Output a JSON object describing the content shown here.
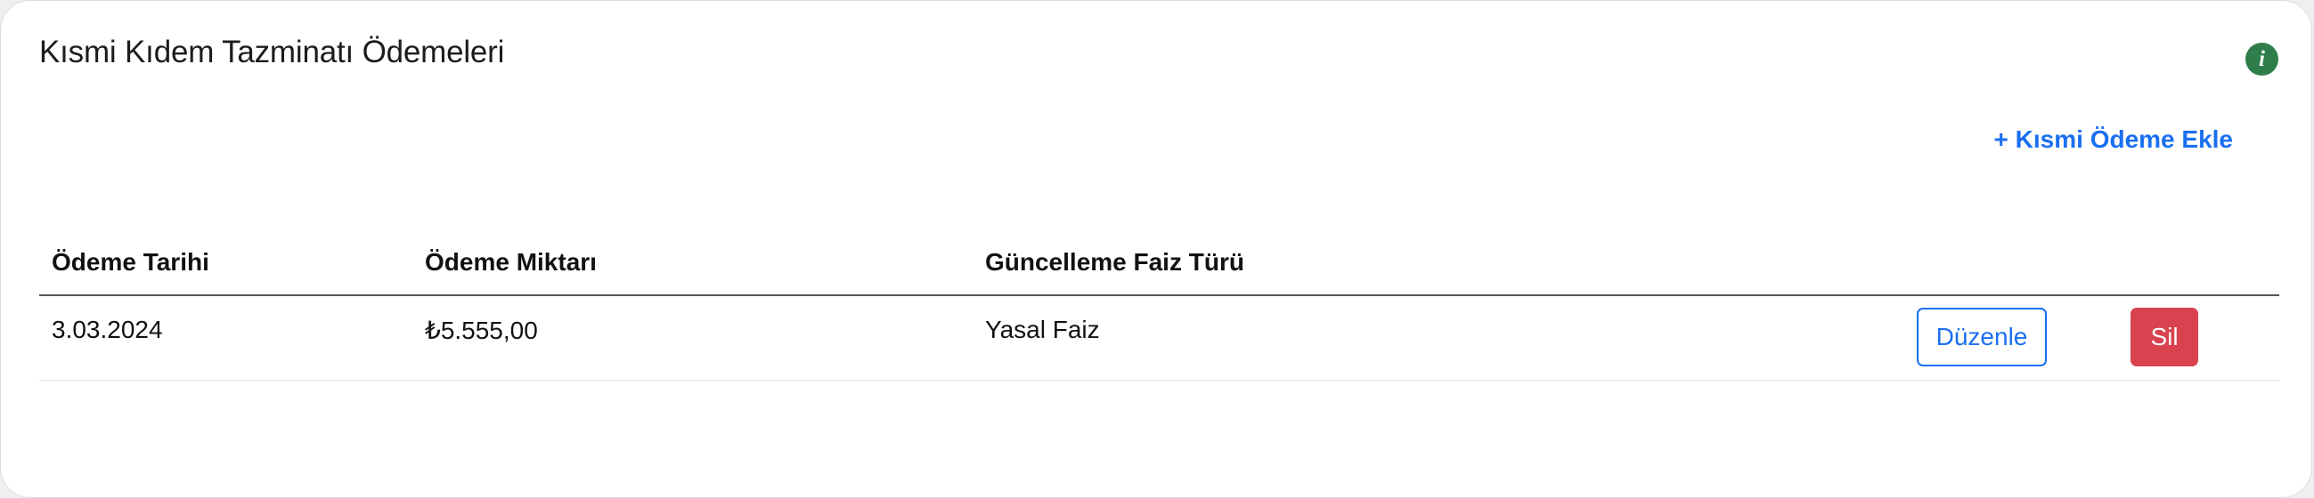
{
  "card": {
    "title": "Kısmi Kıdem Tazminatı Ödemeleri",
    "info_icon": "info-icon",
    "add_link_label": "+ Kısmi Ödeme Ekle"
  },
  "table": {
    "headers": [
      "Ödeme Tarihi",
      "Ödeme Miktarı",
      "Güncelleme Faiz Türü"
    ],
    "rows": [
      {
        "date": "3.03.2024",
        "amount": "₺5.555,00",
        "interest_type": "Yasal Faiz",
        "edit_label": "Düzenle",
        "delete_label": "Sil"
      }
    ]
  },
  "colors": {
    "accent": "#1a6ff0",
    "danger": "#d9434f",
    "info": "#2e7d4a"
  }
}
